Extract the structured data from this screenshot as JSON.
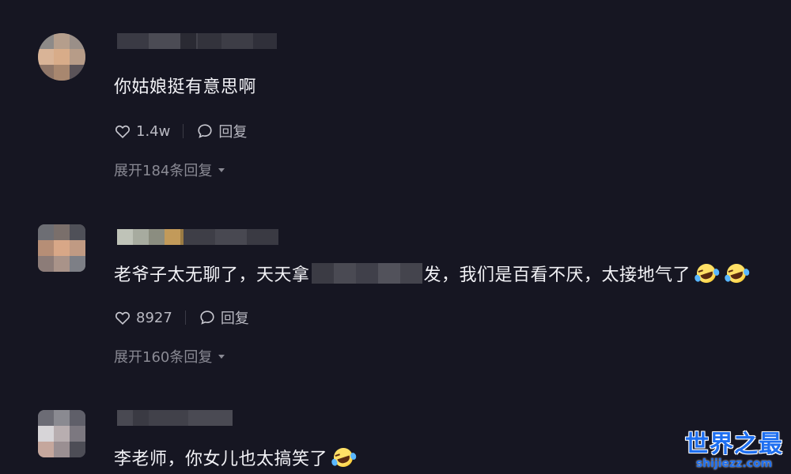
{
  "comments": [
    {
      "text": "你姑娘挺有意思啊",
      "likes": "1.4w",
      "reply_label": "回复",
      "expand_label": "展开184条回复"
    },
    {
      "text_before": "老爷子太无聊了，天天拿",
      "text_after": "发，我们是百看不厌，太接地气了",
      "likes": "8927",
      "reply_label": "回复",
      "expand_label": "展开160条回复"
    },
    {
      "text": "李老师，你女儿也太搞笑了"
    }
  ],
  "icons": {
    "like": "heart-outline-icon",
    "reply": "speech-bubble-icon",
    "emoji": "rolling-laughing-emoji"
  },
  "colors": {
    "background": "#161622",
    "text": "#f2f2f6",
    "secondary": "#b9b9c2",
    "muted": "#8a8a94",
    "watermark": "#1e6ff0"
  },
  "watermark": {
    "title": "世界之最",
    "url": "shijiezz.com"
  }
}
